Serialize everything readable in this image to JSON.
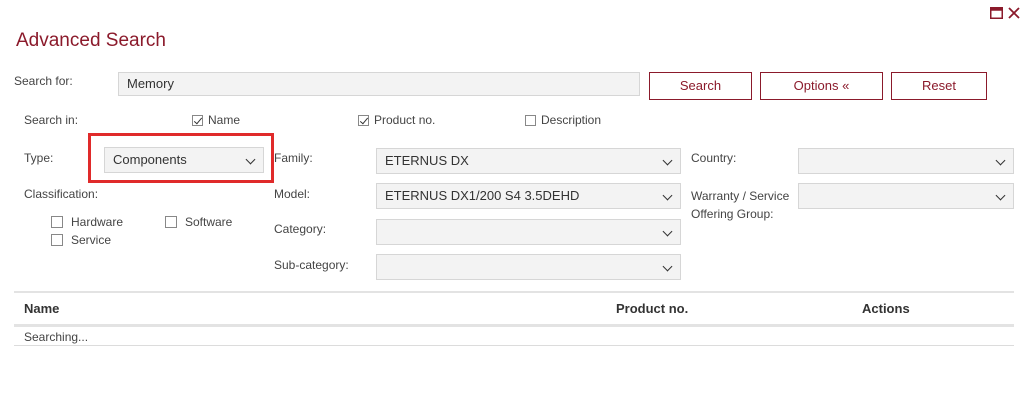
{
  "window": {
    "title": "Advanced Search",
    "maximize_icon": "maximize-icon",
    "close_icon": "close-icon"
  },
  "search": {
    "label": "Search for:",
    "value": "Memory",
    "search_button": "Search",
    "options_button": "Options «",
    "reset_button": "Reset"
  },
  "search_in": {
    "label": "Search in:",
    "options": [
      {
        "label": "Name",
        "checked": true
      },
      {
        "label": "Product no.",
        "checked": true
      },
      {
        "label": "Description",
        "checked": false
      }
    ]
  },
  "type": {
    "label": "Type:",
    "value": "Components"
  },
  "classification": {
    "label": "Classification:",
    "options": [
      {
        "label": "Hardware",
        "checked": false
      },
      {
        "label": "Software",
        "checked": false
      },
      {
        "label": "Service",
        "checked": false
      }
    ]
  },
  "filters": {
    "family": {
      "label": "Family:",
      "value": "ETERNUS DX"
    },
    "model": {
      "label": "Model:",
      "value": "ETERNUS DX1/200 S4 3.5DEHD"
    },
    "category": {
      "label": "Category:",
      "value": ""
    },
    "subcategory": {
      "label": "Sub-category:",
      "value": ""
    },
    "country": {
      "label": "Country:",
      "value": ""
    },
    "warranty": {
      "label_line1": "Warranty / Service",
      "label_line2": "Offering Group:",
      "value": ""
    }
  },
  "results": {
    "columns": [
      "Name",
      "Product no.",
      "Actions"
    ],
    "status": "Searching..."
  },
  "colors": {
    "accent": "#8b1a2b",
    "highlight": "#e02a2a"
  }
}
